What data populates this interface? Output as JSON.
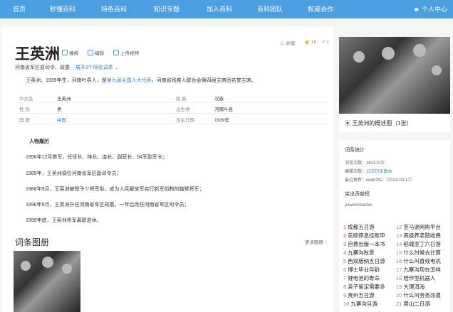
{
  "nav": {
    "items": [
      "首页",
      "秒懂百科",
      "特色百科",
      "知识专题",
      "加入百科",
      "百科团队",
      "权威合作"
    ],
    "user": "个人中心"
  },
  "entry": {
    "title": "王英洲",
    "tools": [
      "播报",
      "编辑",
      "上传视频"
    ],
    "collect": "收藏",
    "likes": "16",
    "shares": "1",
    "subtitle": "河南省军区原司令、政委",
    "homonym": "展开2个同名词条",
    "summary": {
      "pre": "王英洲，1939年生，河南叶县人，是",
      "link": "第九届全国人大代表",
      "post": "，河南省残疾人联合会第四届主席团名誉主席。"
    },
    "info": [
      {
        "k1": "中文名",
        "v1": "王英洲",
        "k2": "民 族",
        "v2": "汉族",
        "v1_blue": false
      },
      {
        "k1": "性 别",
        "v1": "男",
        "k2": "出生地",
        "v2": "河南叶县",
        "v1_blue": false
      },
      {
        "k1": "国 籍",
        "v1": "中国",
        "k2": "出生日期",
        "v2": "1939年",
        "v1_blue": true
      }
    ],
    "resume_title": "人物履历",
    "resume": [
      "1956年12月参军，任班长、排长、连长、副营长、54军副军长；",
      "1985年，王英洲调任河南省军区副司令员；",
      "1988年9月，王英洲被授予少将军衔，成为人民解放军实行新军衔制的独臂将军；",
      "1996年6月，王英洲升任河南省军区政委，一年后改任河南省军区司令员；",
      "1999年底，王英洲将军离职退休。"
    ],
    "gallery_title": "词条图册",
    "gallery_more": "更多图册"
  },
  "sidebar": {
    "caption": "王英洲的概述图（1张）",
    "stats_title": "词条统计",
    "stats": {
      "views_label": "浏览次数：",
      "views": "161370次",
      "edits_label": "编辑次数：",
      "edits": "15次历史版本",
      "last_label": "最近更新：",
      "last": "wiwh282 （2024-03-17）"
    },
    "contrib_title": "突出贡献榜",
    "contrib_user": "yuwenchaofan",
    "hot": [
      {
        "n": "1",
        "t": "成都五日游"
      },
      {
        "n": "2",
        "t": "花呗停息挂账申"
      },
      {
        "n": "3",
        "t": "自费出版一本书"
      },
      {
        "n": "4",
        "t": "九寨沟秋景"
      },
      {
        "n": "5",
        "t": "西双版纳五日游"
      },
      {
        "n": "6",
        "t": "博士毕业年龄"
      },
      {
        "n": "7",
        "t": "锂电池的寿命"
      },
      {
        "n": "8",
        "t": "亲子鉴定需要多"
      },
      {
        "n": "9",
        "t": "贵州五日游"
      },
      {
        "n": "10",
        "t": "九寨沟旦游"
      }
    ],
    "hot2": [
      {
        "n": "12",
        "t": "亚马逊网购平台"
      },
      {
        "n": "13",
        "t": "高级养老院收费"
      },
      {
        "n": "14",
        "t": "稻城亚丁六日游"
      },
      {
        "n": "15",
        "t": "什么时候去计算"
      },
      {
        "n": "16",
        "t": "什么叫直线电机"
      },
      {
        "n": "17",
        "t": "九寨沟现在怎样"
      },
      {
        "n": "18",
        "t": "陪伴型机器人"
      },
      {
        "n": "19",
        "t": "大理洱海"
      },
      {
        "n": "20",
        "t": "什么叫劳务派遣"
      },
      {
        "n": "21",
        "t": "黄山二日游"
      }
    ]
  }
}
